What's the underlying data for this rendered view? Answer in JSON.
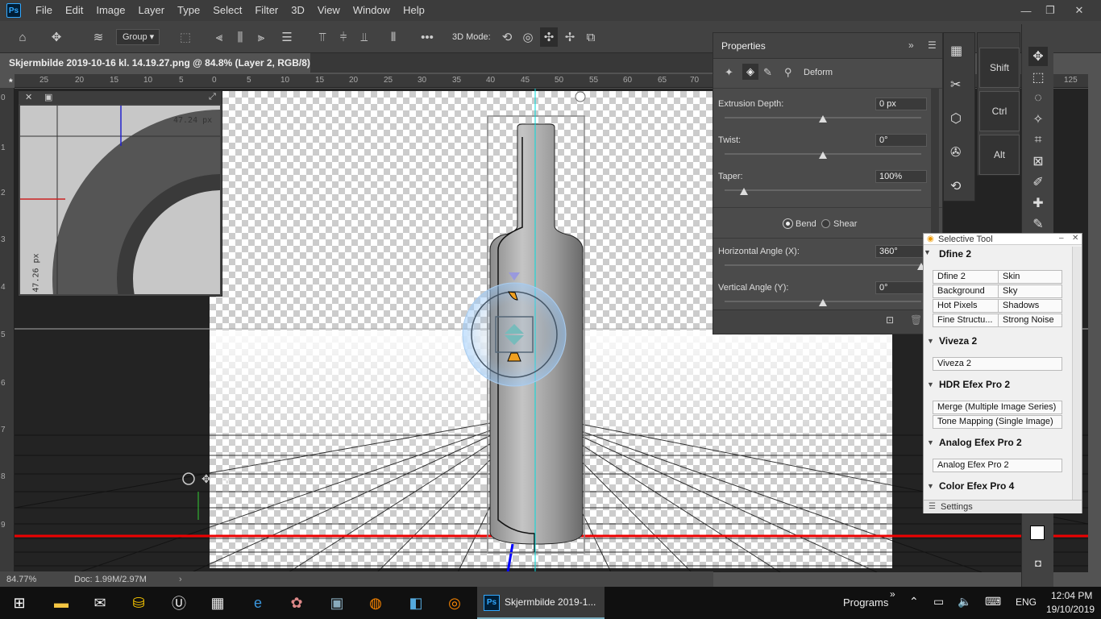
{
  "app": {
    "logo": "Ps",
    "menu": [
      "File",
      "Edit",
      "Image",
      "Layer",
      "Type",
      "Select",
      "Filter",
      "3D",
      "View",
      "Window",
      "Help"
    ],
    "win_min": "—",
    "win_max": "❐",
    "win_close": "✕"
  },
  "options": {
    "group_label": "Group",
    "mode_label": "3D Mode:"
  },
  "document": {
    "tab_title": "Skjermbilde 2019-10-16 kl. 14.19.27.png @ 84.8% (Layer 2, RGB/8) *",
    "tab_close": "×"
  },
  "rulers": {
    "h": [
      "25",
      "20",
      "15",
      "10",
      "5",
      "0",
      "5",
      "10",
      "15",
      "20",
      "25",
      "30",
      "35",
      "40",
      "45",
      "50",
      "55",
      "60",
      "65",
      "70",
      "125"
    ],
    "v": [
      "0",
      "1",
      "2",
      "3",
      "4",
      "5",
      "6",
      "7",
      "8",
      "9"
    ]
  },
  "navigator": {
    "label_top": "47.24 px",
    "label_side": "47.26 px"
  },
  "properties": {
    "title": "Properties",
    "tab_deform": "Deform",
    "extrusion_label": "Extrusion Depth:",
    "extrusion_value": "0 px",
    "extrusion_pos": 0.5,
    "twist_label": "Twist:",
    "twist_value": "0°",
    "twist_pos": 0.5,
    "taper_label": "Taper:",
    "taper_value": "100%",
    "taper_pos": 0.1,
    "bend_label": "Bend",
    "shear_label": "Shear",
    "hangle_label": "Horizontal Angle (X):",
    "hangle_value": "360°",
    "hangle_pos": 1.0,
    "vangle_label": "Vertical Angle (Y):",
    "vangle_value": "0°",
    "vangle_pos": 0.5
  },
  "keys": {
    "shift": "Shift",
    "ctrl": "Ctrl",
    "alt": "Alt"
  },
  "selective_tool": {
    "title": "Selective Tool",
    "dfine_header": "Dfine 2",
    "dfine_buttons": [
      "Dfine 2",
      "Skin",
      "Background",
      "Sky",
      "Hot Pixels",
      "Shadows",
      "Fine Structu...",
      "Strong Noise"
    ],
    "viveza_header": "Viveza 2",
    "viveza_buttons": [
      "Viveza 2"
    ],
    "hdr_header": "HDR Efex Pro 2",
    "hdr_buttons": [
      "Merge (Multiple Image Series)",
      "Tone Mapping (Single Image)"
    ],
    "analog_header": "Analog Efex Pro 2",
    "analog_buttons": [
      "Analog Efex Pro 2"
    ],
    "color_header": "Color Efex Pro 4",
    "settings": "Settings"
  },
  "status": {
    "zoom": "84.77%",
    "doc": "Doc: 1.99M/2.97M"
  },
  "taskbar": {
    "active_app": "Skjermbilde 2019-1...",
    "programs": "Programs",
    "language": "ENG",
    "time": "12:04 PM",
    "date": "19/10/2019"
  },
  "colors": {
    "accent": "#31a8ff",
    "panel": "#4b4b4b"
  }
}
